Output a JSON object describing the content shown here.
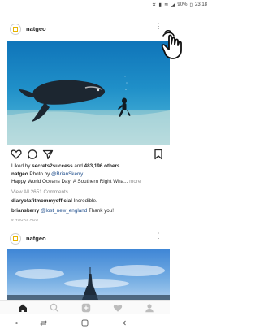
{
  "status_bar": {
    "battery": "90%",
    "time": "23:18"
  },
  "post1": {
    "username": "natgeo",
    "likes_prefix": "Liked by ",
    "liked_by_user": "secrets2success",
    "likes_mid": " and ",
    "likes_count": "483,196 others",
    "caption_user": "natgeo",
    "caption_photo_by": " Photo by ",
    "caption_mention": "@BrianSkerry",
    "caption_text": "Happy World Oceans Day! A Southern Right Wha...",
    "caption_more": "more",
    "view_all_comments": "View All 2651 Comments",
    "comments": [
      {
        "user": "diaryofafitmommyofficial",
        "mention": "",
        "text": " Incredible."
      },
      {
        "user": "brianskerry",
        "mention": " @lost_new_england",
        "text": " Thank you!"
      }
    ],
    "time_ago": "9 HOURS AGO"
  },
  "post2": {
    "username": "natgeo"
  },
  "icons": {
    "more": "more-options-icon",
    "like": "heart-icon",
    "comment": "comment-icon",
    "share": "share-icon",
    "save": "bookmark-icon",
    "nav_home": "home-icon",
    "nav_search": "search-icon",
    "nav_add": "add-post-icon",
    "nav_activity": "activity-heart-icon",
    "nav_profile": "profile-icon"
  },
  "colors": {
    "mention_link": "#1b4b8a",
    "secondary_text": "#8e8e8e",
    "natgeo_yellow": "#e7b400"
  }
}
